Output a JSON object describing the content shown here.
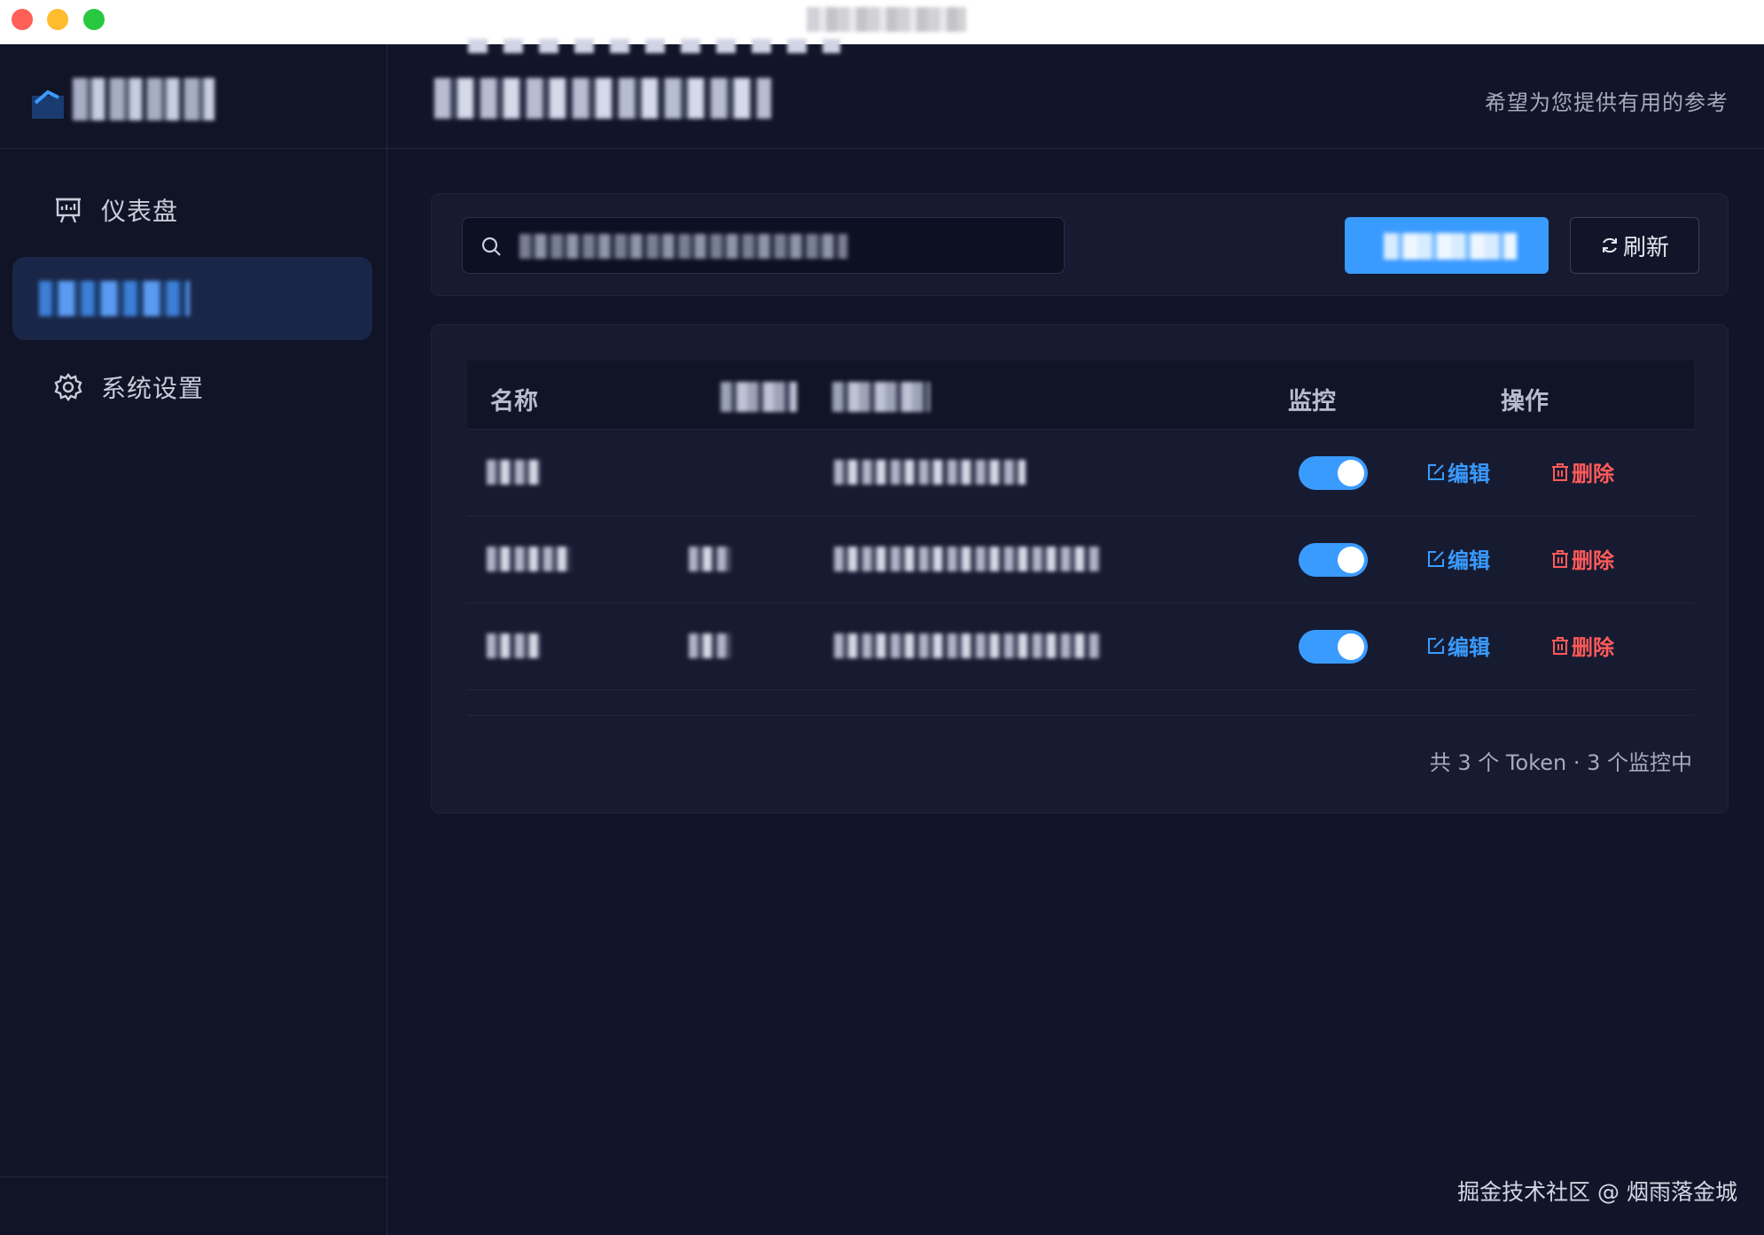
{
  "sidebar": {
    "items": [
      {
        "label": "仪表盘",
        "icon": "presentation-board-icon"
      },
      {
        "label": "",
        "icon": "tag-icon",
        "active": true
      },
      {
        "label": "系统设置",
        "icon": "gear-icon"
      }
    ]
  },
  "header": {
    "subtitle": "希望为您提供有用的参考"
  },
  "toolbar": {
    "refresh_label": "刷新"
  },
  "table": {
    "columns": [
      "名称",
      "",
      "",
      "监控",
      "操作"
    ],
    "rows": [
      {
        "monitor": true,
        "edit_label": "编辑",
        "delete_label": "删除"
      },
      {
        "monitor": true,
        "edit_label": "编辑",
        "delete_label": "删除"
      },
      {
        "monitor": true,
        "edit_label": "编辑",
        "delete_label": "删除"
      }
    ]
  },
  "summary": "共 3 个 Token  ·  3 个监控中",
  "watermark": "掘金技术社区 @ 烟雨落金城",
  "colors": {
    "accent": "#3a9bff",
    "danger": "#ff5a5a",
    "background": "#12152a"
  }
}
